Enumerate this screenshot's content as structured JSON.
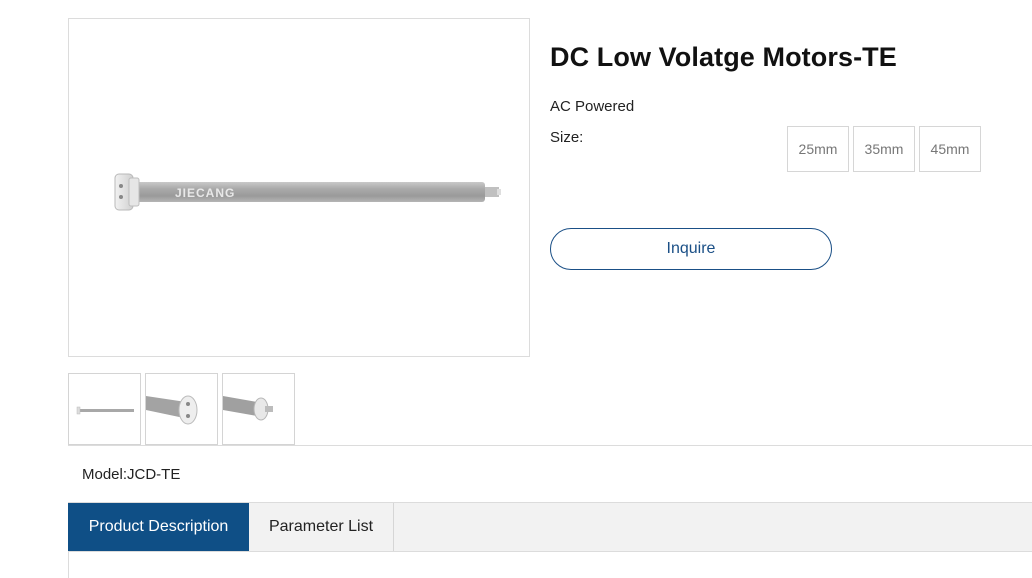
{
  "product": {
    "title": "DC Low Volatge Motors-TE",
    "subtitle": "AC Powered",
    "size_label": "Size:",
    "sizes": [
      "25mm",
      "35mm",
      "45mm"
    ],
    "inquire_label": "Inquire",
    "model": "Model:JCD-TE",
    "image_logo_text": "JIECANG"
  },
  "gallery": {
    "thumbnails": [
      "motor-full-view",
      "motor-head-closeup",
      "motor-end-closeup"
    ]
  },
  "tabs": [
    {
      "label": "Product Description",
      "active": true
    },
    {
      "label": "Parameter List",
      "active": false
    }
  ],
  "colors": {
    "accent": "#0f4f86",
    "border": "#dcdcdc",
    "tab_bar": "#f2f2f2"
  }
}
